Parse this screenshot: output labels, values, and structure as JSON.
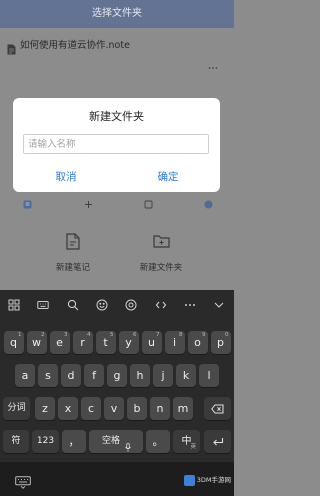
{
  "header": {
    "title": "选择文件夹"
  },
  "file_list": [
    {
      "name": "如何使用有道云协作.note",
      "icon": "note-icon"
    }
  ],
  "quick_actions": [
    {
      "label": "新建笔记",
      "icon": "new-note-icon"
    },
    {
      "label": "新建文件夹",
      "icon": "new-folder-icon"
    }
  ],
  "dialog": {
    "title": "新建文件夹",
    "input": {
      "value": "",
      "placeholder": "请输入名称"
    },
    "cancel_label": "取消",
    "confirm_label": "确定"
  },
  "keyboard": {
    "toolbar_icons": [
      "grid-icon",
      "keyboard-layout-icon",
      "search-icon",
      "emoji-icon",
      "target-icon",
      "angle-brackets-icon",
      "more-icon",
      "chevron-down-icon"
    ],
    "row1": [
      {
        "key": "q",
        "hint": "1"
      },
      {
        "key": "w",
        "hint": "2"
      },
      {
        "key": "e",
        "hint": "3"
      },
      {
        "key": "r",
        "hint": "4"
      },
      {
        "key": "t",
        "hint": "5"
      },
      {
        "key": "y",
        "hint": "6"
      },
      {
        "key": "u",
        "hint": "7"
      },
      {
        "key": "i",
        "hint": "8"
      },
      {
        "key": "o",
        "hint": "9"
      },
      {
        "key": "p",
        "hint": "0"
      }
    ],
    "row2": [
      {
        "key": "a"
      },
      {
        "key": "s"
      },
      {
        "key": "d"
      },
      {
        "key": "f"
      },
      {
        "key": "g"
      },
      {
        "key": "h"
      },
      {
        "key": "j"
      },
      {
        "key": "k"
      },
      {
        "key": "l"
      }
    ],
    "row3": [
      {
        "key": "z"
      },
      {
        "key": "x"
      },
      {
        "key": "c"
      },
      {
        "key": "v"
      },
      {
        "key": "b"
      },
      {
        "key": "n"
      },
      {
        "key": "m"
      }
    ],
    "fenci_label": "分词",
    "symbol_label": "符",
    "number_label": "123",
    "comma_label": "，",
    "space_label": "空格",
    "period_label": "。",
    "lang_label": "中",
    "lang_sub_label": "英",
    "backspace_icon": "backspace-icon",
    "return_icon": "return-icon",
    "mic_icon": "microphone-icon"
  },
  "system_nav": {
    "icon": "keyboard-hide-icon"
  },
  "watermark": "3DM手游网",
  "colors": {
    "accent": "#2f7bdd",
    "header": "#637393",
    "keyboard_bg": "#2a2a2a",
    "key_bg": "#4a4a4a"
  }
}
